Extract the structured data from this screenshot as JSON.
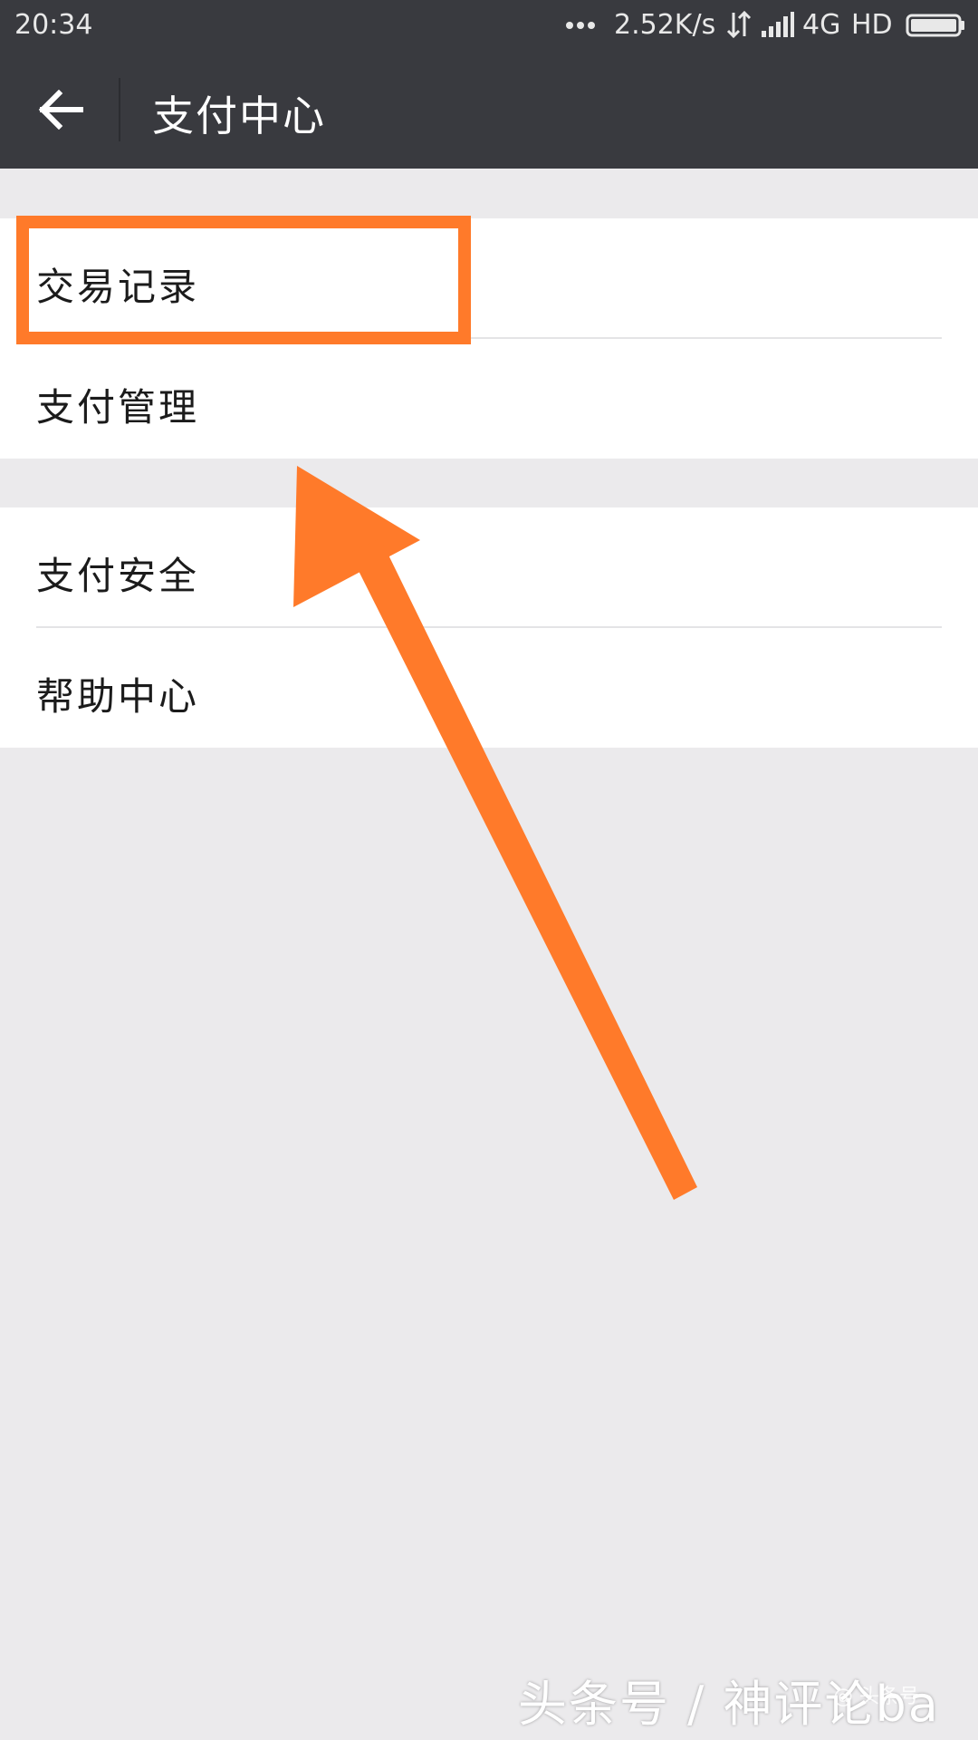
{
  "status_bar": {
    "time": "20:34",
    "speed": "2.52K/s",
    "network": "4G",
    "hd": "HD",
    "icons": [
      "more-dots-icon",
      "data-transfer-icon",
      "signal-icon",
      "battery-icon"
    ]
  },
  "header": {
    "title": "支付中心",
    "back_icon": "arrow-left-icon"
  },
  "groups": [
    {
      "items": [
        {
          "label": "交易记录"
        },
        {
          "label": "支付管理"
        }
      ]
    },
    {
      "items": [
        {
          "label": "支付安全"
        },
        {
          "label": "帮助中心"
        }
      ]
    }
  ],
  "annotation": {
    "color": "#ff7a2a",
    "highlighted_item": "交易记录"
  },
  "watermark": {
    "text": "头条号 / 神评论ba",
    "small_text": "@ 头条号"
  },
  "colors": {
    "header_bg": "#393a3f",
    "page_bg": "#ebeaec",
    "row_bg": "#ffffff"
  }
}
